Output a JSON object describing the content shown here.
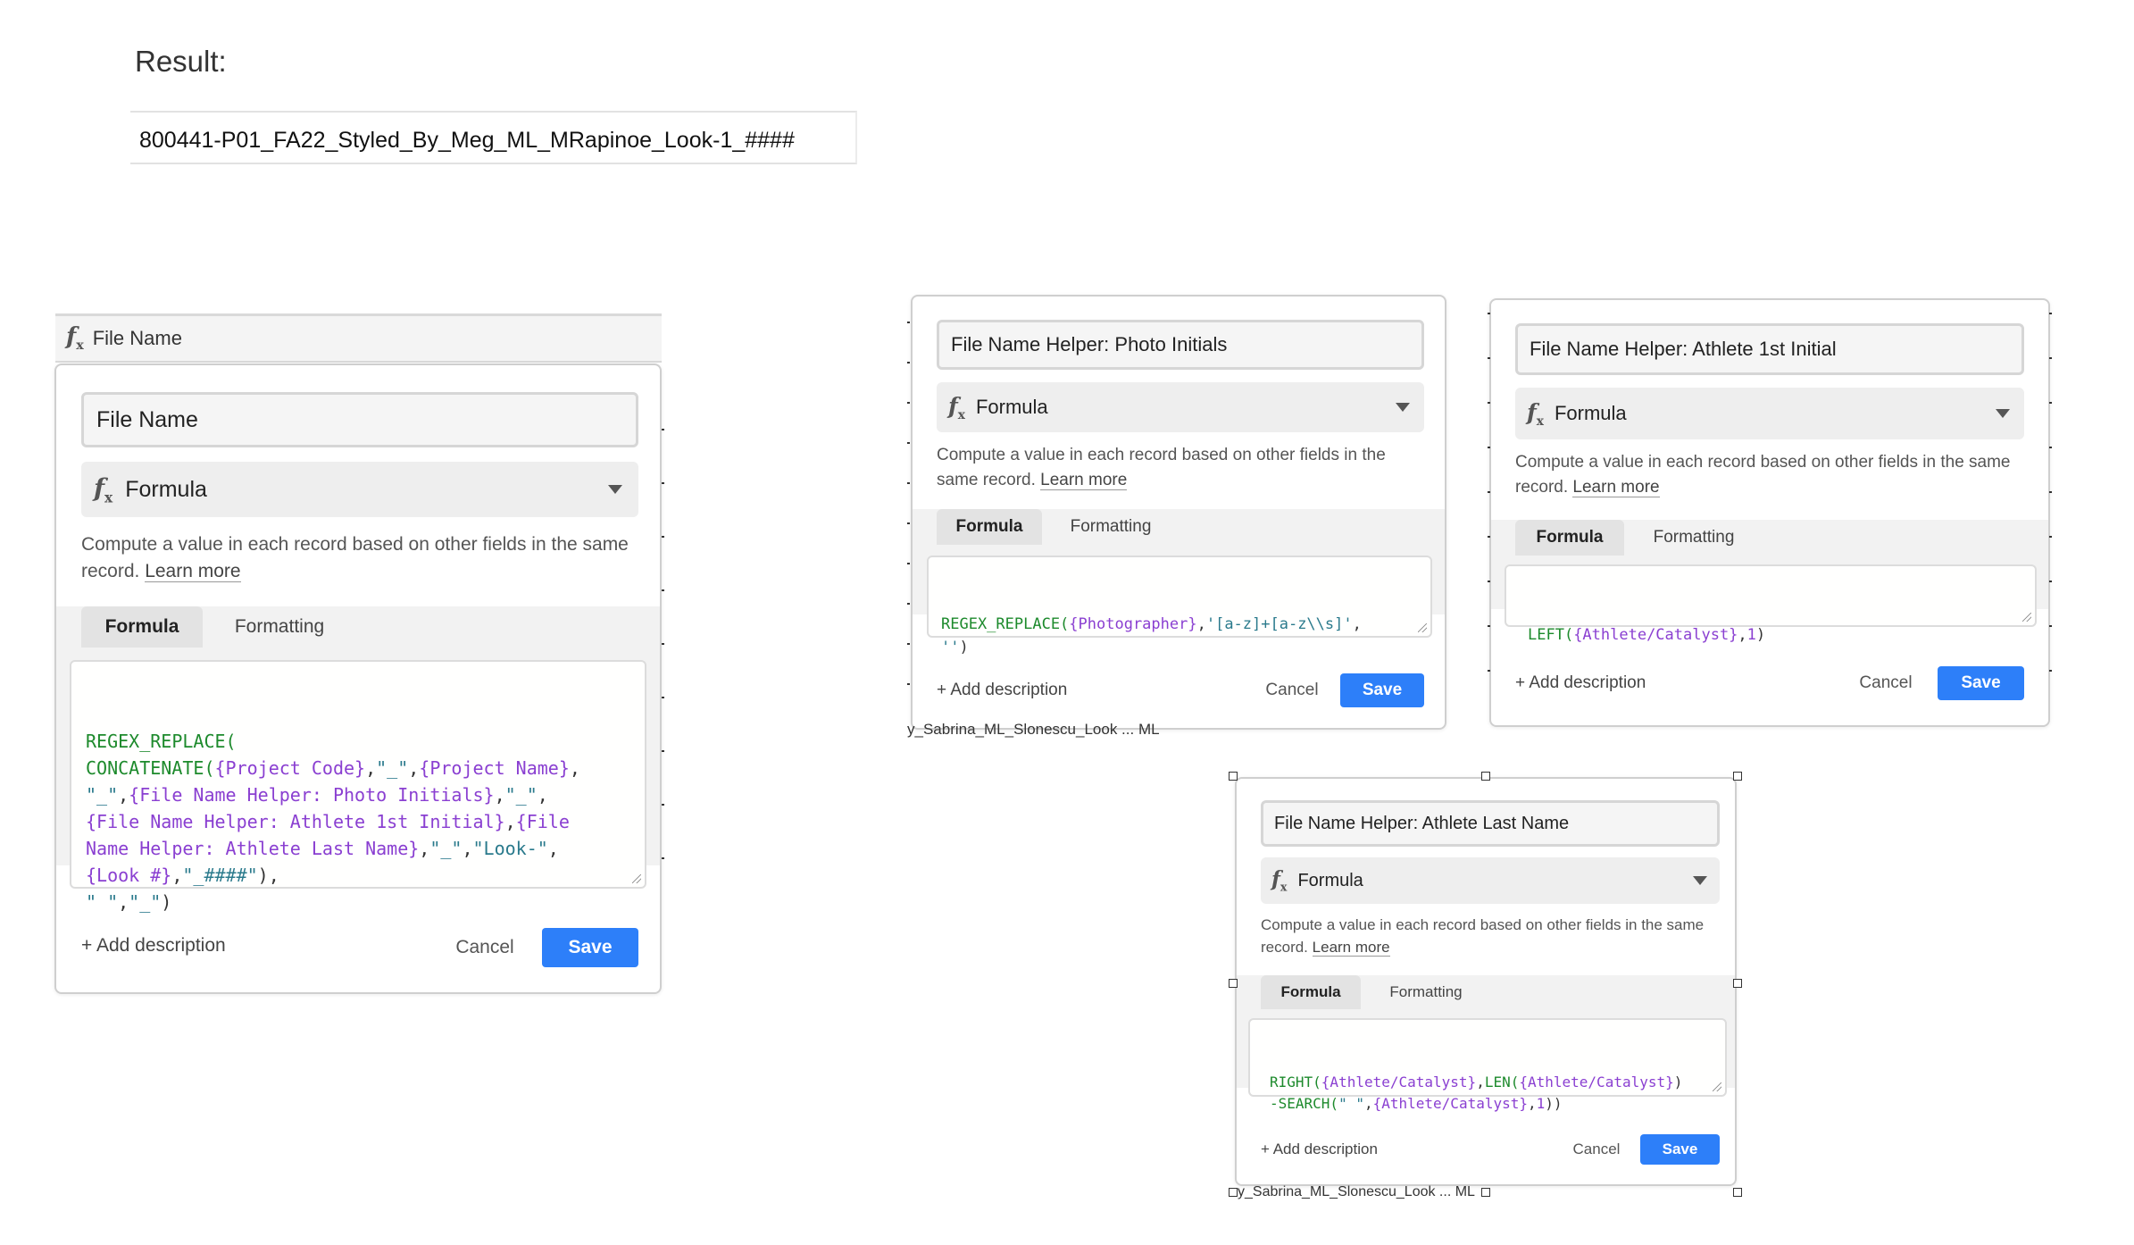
{
  "result": {
    "label": "Result:",
    "value": "800441-P01_FA22_Styled_By_Meg_ML_MRapinoe_Look-1_####"
  },
  "column_header": {
    "icon": "formula-icon",
    "label": "File Name"
  },
  "panels": [
    {
      "field_name": "File Name",
      "type_label": "Formula",
      "type_icon": "formula-icon",
      "description": "Compute a value in each record based on other fields in the same record.",
      "learn_more": "Learn more",
      "tab_formula": "Formula",
      "tab_formatting": "Formatting",
      "formula": [
        [
          [
            "fn",
            "REGEX_REPLACE("
          ]
        ],
        [
          [
            "fn",
            "CONCATENATE("
          ],
          [
            "fld",
            "{Project Code}"
          ],
          [
            "plain",
            ","
          ],
          [
            "str",
            "\"_\""
          ],
          [
            "plain",
            ","
          ],
          [
            "fld",
            "{Project Name}"
          ],
          [
            "plain",
            ","
          ]
        ],
        [
          [
            "str",
            "\"_\""
          ],
          [
            "plain",
            ","
          ],
          [
            "fld",
            "{File Name Helper: Photo Initials}"
          ],
          [
            "plain",
            ","
          ],
          [
            "str",
            "\"_\""
          ],
          [
            "plain",
            ","
          ]
        ],
        [
          [
            "fld",
            "{File Name Helper: Athlete 1st Initial}"
          ],
          [
            "plain",
            ","
          ],
          [
            "fld",
            "{File"
          ]
        ],
        [
          [
            "fld",
            "Name Helper: Athlete Last Name}"
          ],
          [
            "plain",
            ","
          ],
          [
            "str",
            "\"_\""
          ],
          [
            "plain",
            ","
          ],
          [
            "str",
            "\"Look-\""
          ],
          [
            "plain",
            ","
          ]
        ],
        [
          [
            "fld",
            "{Look #}"
          ],
          [
            "plain",
            ","
          ],
          [
            "str",
            "\"_####\""
          ],
          [
            "plain",
            "),"
          ]
        ],
        [
          [
            "str",
            "\" \""
          ],
          [
            "plain",
            ","
          ],
          [
            "str",
            "\"_\""
          ],
          [
            "plain",
            ")"
          ]
        ]
      ],
      "add_description": "+ Add description",
      "cancel": "Cancel",
      "save": "Save"
    },
    {
      "field_name": "File Name Helper: Photo Initials",
      "type_label": "Formula",
      "type_icon": "formula-icon",
      "description": "Compute a value in each record based on other fields in the same record.",
      "learn_more": "Learn more",
      "tab_formula": "Formula",
      "tab_formatting": "Formatting",
      "formula": [
        [
          [
            "fn",
            "REGEX_REPLACE("
          ],
          [
            "fld",
            "{Photographer}"
          ],
          [
            "plain",
            ","
          ],
          [
            "str",
            "'[a-z]+[a-z\\\\s]'"
          ],
          [
            "plain",
            ","
          ]
        ],
        [
          [
            "str",
            "''"
          ],
          [
            "plain",
            ")"
          ]
        ]
      ],
      "add_description": "+ Add description",
      "cancel": "Cancel",
      "save": "Save",
      "fragment": "y_Sabrina_ML_Slonescu_Look ... ML"
    },
    {
      "field_name": "File Name Helper: Athlete 1st Initial",
      "type_label": "Formula",
      "type_icon": "formula-icon",
      "description": "Compute a value in each record based on other fields in the same record.",
      "learn_more": "Learn more",
      "tab_formula": "Formula",
      "tab_formatting": "Formatting",
      "formula": [
        [
          [
            "fn",
            "LEFT("
          ],
          [
            "fld",
            "{Athlete/Catalyst}"
          ],
          [
            "plain",
            ","
          ],
          [
            "num",
            "1"
          ],
          [
            "plain",
            ")"
          ]
        ]
      ],
      "add_description": "+ Add description",
      "cancel": "Cancel",
      "save": "Save"
    },
    {
      "field_name": "File Name Helper: Athlete Last Name",
      "type_label": "Formula",
      "type_icon": "formula-icon",
      "description": "Compute a value in each record based on other fields in the same record.",
      "learn_more": "Learn more",
      "tab_formula": "Formula",
      "tab_formatting": "Formatting",
      "formula": [
        [
          [
            "fn",
            "RIGHT("
          ],
          [
            "fld",
            "{Athlete/Catalyst}"
          ],
          [
            "plain",
            ","
          ],
          [
            "fn",
            "LEN("
          ],
          [
            "fld",
            "{Athlete/Catalyst}"
          ],
          [
            "plain",
            ")"
          ]
        ],
        [
          [
            "fn",
            "-SEARCH("
          ],
          [
            "str",
            "\" \""
          ],
          [
            "plain",
            ","
          ],
          [
            "fld",
            "{Athlete/Catalyst}"
          ],
          [
            "plain",
            ","
          ],
          [
            "num",
            "1"
          ],
          [
            "plain",
            "))"
          ]
        ]
      ],
      "add_description": "+ Add description",
      "cancel": "Cancel",
      "save": "Save",
      "fragment": "y_Sabrina_ML_Slonescu_Look ... ML"
    }
  ]
}
